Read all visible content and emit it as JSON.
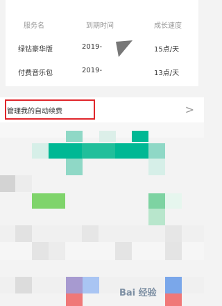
{
  "table": {
    "headers": [
      "服务名",
      "到期时间",
      "成长速度"
    ],
    "rows": [
      {
        "name": "绿钻豪华版",
        "date": "2019-",
        "speed": "15点/天"
      },
      {
        "name": "付费音乐包",
        "date": "2019-",
        "speed": "13点/天"
      }
    ]
  },
  "manage": {
    "label": "管理我的自动续费",
    "chevron": ">"
  },
  "watermark": {
    "text": "Bai 经验"
  },
  "colors": {
    "highlight": "#e0262b",
    "mosaic_green": "#00b894"
  }
}
